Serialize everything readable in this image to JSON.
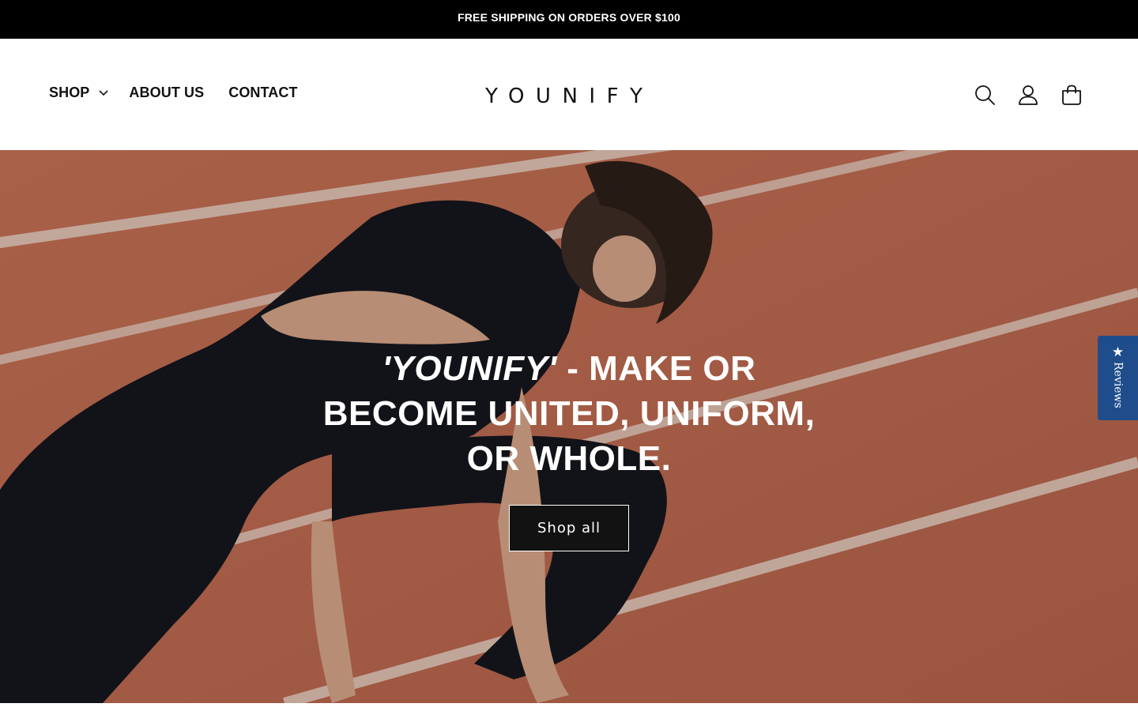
{
  "announcement": {
    "text": "FREE SHIPPING ON ORDERS OVER $100"
  },
  "header": {
    "nav": [
      {
        "label": "SHOP",
        "has_dropdown": true
      },
      {
        "label": "ABOUT US"
      },
      {
        "label": "CONTACT"
      }
    ],
    "logo": "YOUNIFY",
    "icons": [
      "search-icon",
      "account-icon",
      "cart-icon"
    ]
  },
  "hero": {
    "headline_brand": "'YOUNIFY'",
    "headline_rest": " - MAKE OR BECOME UNITED, UNIFORM, OR WHOLE.",
    "button_label": "Shop all"
  },
  "reviews_tab": {
    "label": "Reviews",
    "icon": "star-icon",
    "color": "#1f4d8c"
  },
  "colors": {
    "announcement_bg": "#000000",
    "track": "#b66a52",
    "text": "#121212"
  }
}
